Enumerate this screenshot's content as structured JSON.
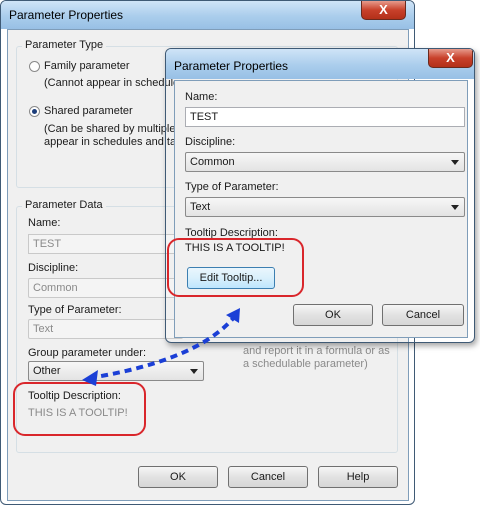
{
  "back_dialog": {
    "title": "Parameter Properties",
    "close_glyph": "X",
    "parameter_type": {
      "group_title": "Parameter Type",
      "family_label": "Family parameter",
      "family_note": "(Cannot appear in schedule",
      "shared_label": "Shared parameter",
      "shared_note_line1": "(Can be shared by multiple",
      "shared_note_line2": "appear in schedules and ta"
    },
    "parameter_data": {
      "group_title": "Parameter Data",
      "name_label": "Name:",
      "name_value": "TEST",
      "discipline_label": "Discipline:",
      "discipline_value": "Common",
      "type_label": "Type of Parameter:",
      "type_value": "Text",
      "group_under_label": "Group parameter under:",
      "group_under_value": "Other",
      "tooltip_label": "Tooltip Description:",
      "tooltip_value": "THIS IS A TOOLTIP!",
      "note_line1": "and report it in a formula or as",
      "note_line2": "a schedulable parameter)"
    },
    "buttons": {
      "ok": "OK",
      "cancel": "Cancel",
      "help": "Help"
    }
  },
  "front_dialog": {
    "title": "Parameter Properties",
    "close_glyph": "X",
    "name_label": "Name:",
    "name_value": "TEST",
    "discipline_label": "Discipline:",
    "discipline_value": "Common",
    "type_label": "Type of Parameter:",
    "type_value": "Text",
    "tooltip_label": "Tooltip Description:",
    "tooltip_value": "THIS IS A TOOLTIP!",
    "edit_tooltip_button": "Edit Tooltip...",
    "buttons": {
      "ok": "OK",
      "cancel": "Cancel"
    }
  },
  "colors": {
    "callout": "#d9262b",
    "arrow": "#1b3fd6",
    "title_bar": "#aacdec",
    "close_button": "#c8412b"
  }
}
